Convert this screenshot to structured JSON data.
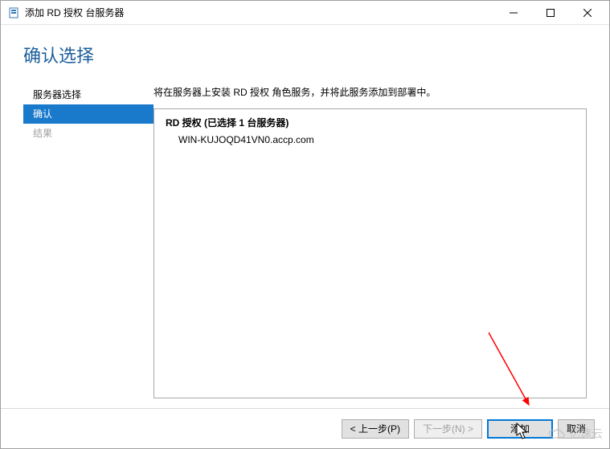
{
  "window": {
    "title": "添加 RD 授权 台服务器"
  },
  "page": {
    "title": "确认选择"
  },
  "sidebar": {
    "items": [
      {
        "label": "服务器选择",
        "state": "normal"
      },
      {
        "label": "确认",
        "state": "selected"
      },
      {
        "label": "结果",
        "state": "disabled"
      }
    ]
  },
  "main": {
    "intro": "将在服务器上安装 RD 授权 角色服务，并将此服务添加到部署中。",
    "list_heading": "RD 授权  (已选择 1 台服务器)",
    "servers": [
      "WIN-KUJOQD41VN0.accp.com"
    ]
  },
  "footer": {
    "previous": "< 上一步(P)",
    "next": "下一步(N) >",
    "add": "添加",
    "cancel": "取消"
  },
  "watermark": "亿速云"
}
